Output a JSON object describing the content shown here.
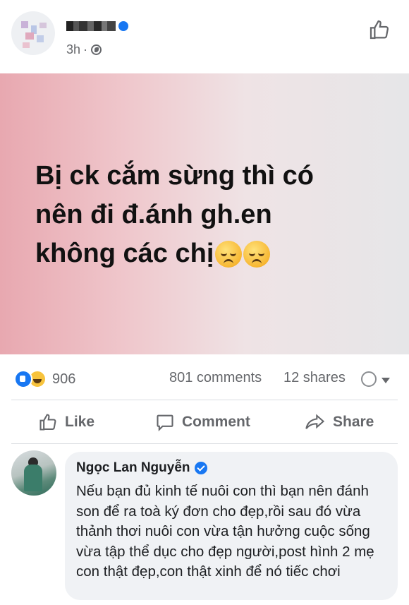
{
  "post": {
    "author_name": "",
    "time": "3h",
    "separator": "·",
    "hero_text_lines": [
      "Bị ck cắm sừng thì có",
      "nên đi đ.ánh gh.en",
      "không các chị"
    ]
  },
  "stats": {
    "reaction_count": "906",
    "comments": "801 comments",
    "shares": "12 shares"
  },
  "actions": {
    "like": "Like",
    "comment": "Comment",
    "share": "Share"
  },
  "comment": {
    "author": "Ngọc Lan Nguyễn",
    "text": "Nếu bạn đủ kinh tế nuôi con thì bạn nên đánh son để ra toà ký đơn cho đẹp,rồi sau đó vừa thảnh thơi nuôi con vừa tận hưởng cuộc sống vừa tập thể dục cho đẹp người,post hình 2 mẹ con thật đẹp,con thật xinh để nó tiếc chơi"
  },
  "colors": {
    "accent": "#1877f2",
    "secondary_text": "#65676b"
  }
}
